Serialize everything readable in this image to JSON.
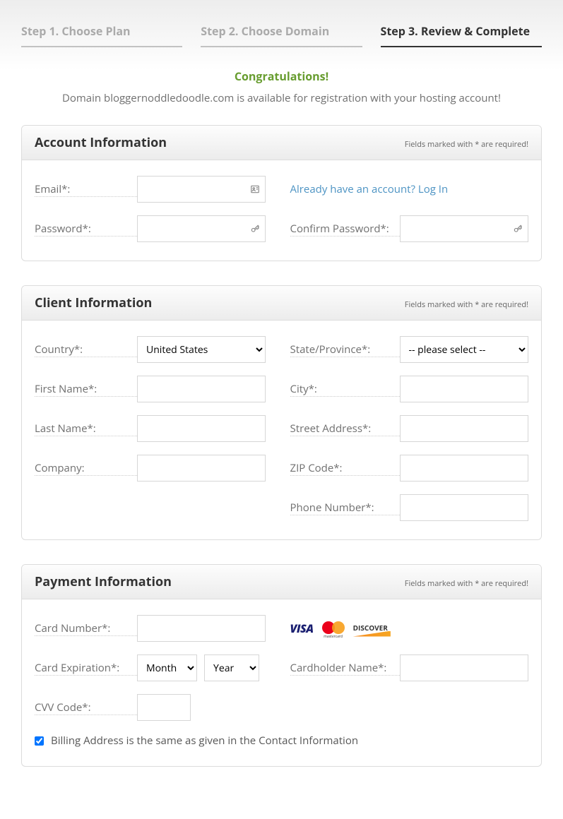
{
  "steps": {
    "step1": "Step 1. Choose Plan",
    "step2": "Step 2. Choose Domain",
    "step3": "Step 3. Review & Complete"
  },
  "banner": {
    "congrats": "Congratulations!",
    "subtext": "Domain bloggernoddledoodle.com is available for registration with your hosting account!"
  },
  "required_note": "Fields marked with * are required!",
  "account": {
    "title": "Account Information",
    "email_label": "Email*:",
    "password_label": "Password*:",
    "confirm_label": "Confirm Password*:",
    "login_link": "Already have an account? Log In"
  },
  "client": {
    "title": "Client Information",
    "country_label": "Country*:",
    "country_value": "United States",
    "first_name_label": "First Name*:",
    "last_name_label": "Last Name*:",
    "company_label": "Company:",
    "state_label": "State/Province*:",
    "state_placeholder": "-- please select --",
    "city_label": "City*:",
    "street_label": "Street Address*:",
    "zip_label": "ZIP Code*:",
    "phone_label": "Phone Number*:"
  },
  "payment": {
    "title": "Payment Information",
    "card_number_label": "Card Number*:",
    "expiration_label": "Card Expiration*:",
    "month_placeholder": "Month",
    "year_placeholder": "Year",
    "cvv_label": "CVV Code*:",
    "cardholder_label": "Cardholder Name*:",
    "billing_same": "Billing Address is the same as given in the Contact Information",
    "logos": {
      "visa": "VISA",
      "mastercard": "mastercard",
      "discover": "DISCOVER"
    }
  }
}
